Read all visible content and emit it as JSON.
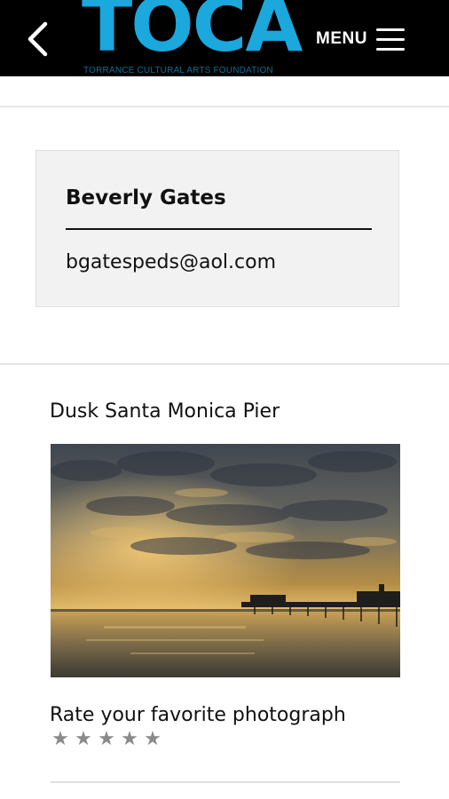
{
  "header": {
    "logo_text": "TOCA",
    "logo_subtitle": "TORRANCE CULTURAL ARTS FOUNDATION",
    "menu_label": "MENU",
    "back_icon": "chevron-left-icon",
    "menu_icon": "hamburger-icon",
    "colors": {
      "bar": "#000000",
      "logo": "#1aa8dd"
    }
  },
  "profile": {
    "name": "Beverly Gates",
    "email": "bgatespeds@aol.com"
  },
  "entry": {
    "title": "Dusk Santa Monica Pier",
    "rate_label": "Rate your favorite photograph",
    "rating": {
      "value": 0,
      "max": 5,
      "star_icon": "star-icon",
      "star_color": "#8a8a8a"
    }
  }
}
